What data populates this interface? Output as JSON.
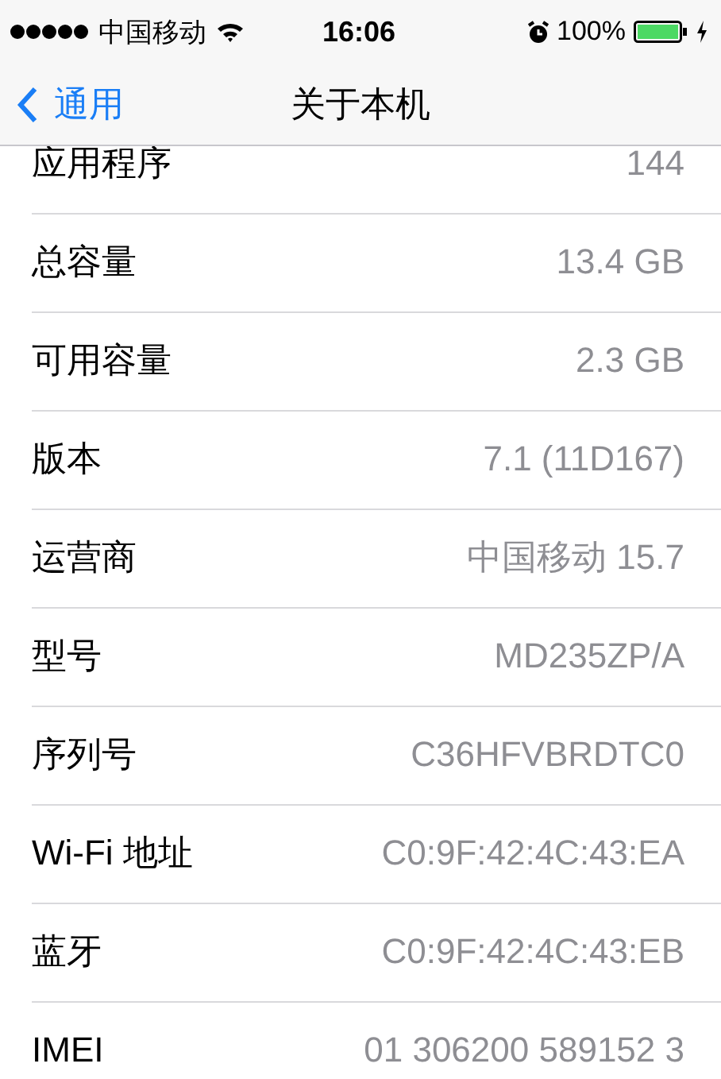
{
  "status_bar": {
    "carrier": "中国移动",
    "time": "16:06",
    "battery": "100%"
  },
  "nav_bar": {
    "back": "通用",
    "title": "关于本机"
  },
  "rows": [
    {
      "label": "应用程序",
      "value": "144"
    },
    {
      "label": "总容量",
      "value": "13.4 GB"
    },
    {
      "label": "可用容量",
      "value": "2.3 GB"
    },
    {
      "label": "版本",
      "value": "7.1 (11D167)"
    },
    {
      "label": "运营商",
      "value": "中国移动 15.7"
    },
    {
      "label": "型号",
      "value": "MD235ZP/A"
    },
    {
      "label": "序列号",
      "value": "C36HFVBRDTC0"
    },
    {
      "label": "Wi-Fi 地址",
      "value": "C0:9F:42:4C:43:EA"
    },
    {
      "label": "蓝牙",
      "value": "C0:9F:42:4C:43:EB"
    },
    {
      "label": "IMEI",
      "value": "01 306200 589152 3"
    }
  ]
}
